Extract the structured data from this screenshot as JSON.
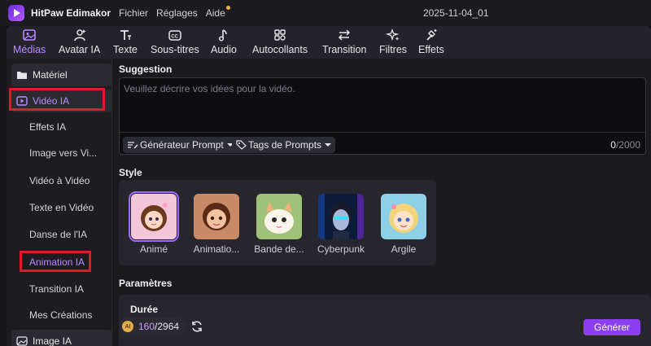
{
  "titlebar": {
    "app_name": "HitPaw Edimakor",
    "menu": [
      "Fichier",
      "Réglages",
      "Aide"
    ],
    "project_title": "2025-11-04_01"
  },
  "toolbar": {
    "tabs": [
      {
        "label": "Médias",
        "icon": "media-icon",
        "active": true
      },
      {
        "label": "Avatar IA",
        "icon": "avatar-icon"
      },
      {
        "label": "Texte",
        "icon": "text-icon"
      },
      {
        "label": "Sous-titres",
        "icon": "subtitles-icon"
      },
      {
        "label": "Audio",
        "icon": "music-note-icon"
      },
      {
        "label": "Autocollants",
        "icon": "stickers-icon"
      },
      {
        "label": "Transition",
        "icon": "transition-icon"
      },
      {
        "label": "Filtres",
        "icon": "filters-icon"
      },
      {
        "label": "Effets",
        "icon": "effects-icon"
      }
    ]
  },
  "sidebar": {
    "material_label": "Matériel",
    "video_ia_label": "Vidéo IA",
    "items": [
      "Effets IA",
      "Image vers Vi...",
      "Vidéo à Vidéo",
      "Texte en Vidéo",
      "Danse de l'IA",
      "Animation IA",
      "Transition IA",
      "Mes Créations"
    ],
    "image_ia_label": "Image IA"
  },
  "suggestion": {
    "title": "Suggestion",
    "placeholder": "Veuillez décrire vos idées pour la vidéo.",
    "generator_label": "Générateur Prompt",
    "tags_label": "Tags de Prompts",
    "count_current": "0",
    "count_max": "/2000"
  },
  "style": {
    "title": "Style",
    "options": [
      {
        "label": "Animé",
        "selected": true
      },
      {
        "label": "Animatio..."
      },
      {
        "label": "Bande de..."
      },
      {
        "label": "Cyberpunk"
      },
      {
        "label": "Argile"
      }
    ]
  },
  "parameters": {
    "title": "Paramètres",
    "duration_label": "Durée"
  },
  "footer": {
    "credits_used": "160",
    "credits_total": "/2964",
    "coin_label": "AI",
    "generate_label": "Générer"
  },
  "colors": {
    "accent": "#b78bff",
    "generate": "#8b3ff0",
    "highlight": "#e0192b"
  }
}
